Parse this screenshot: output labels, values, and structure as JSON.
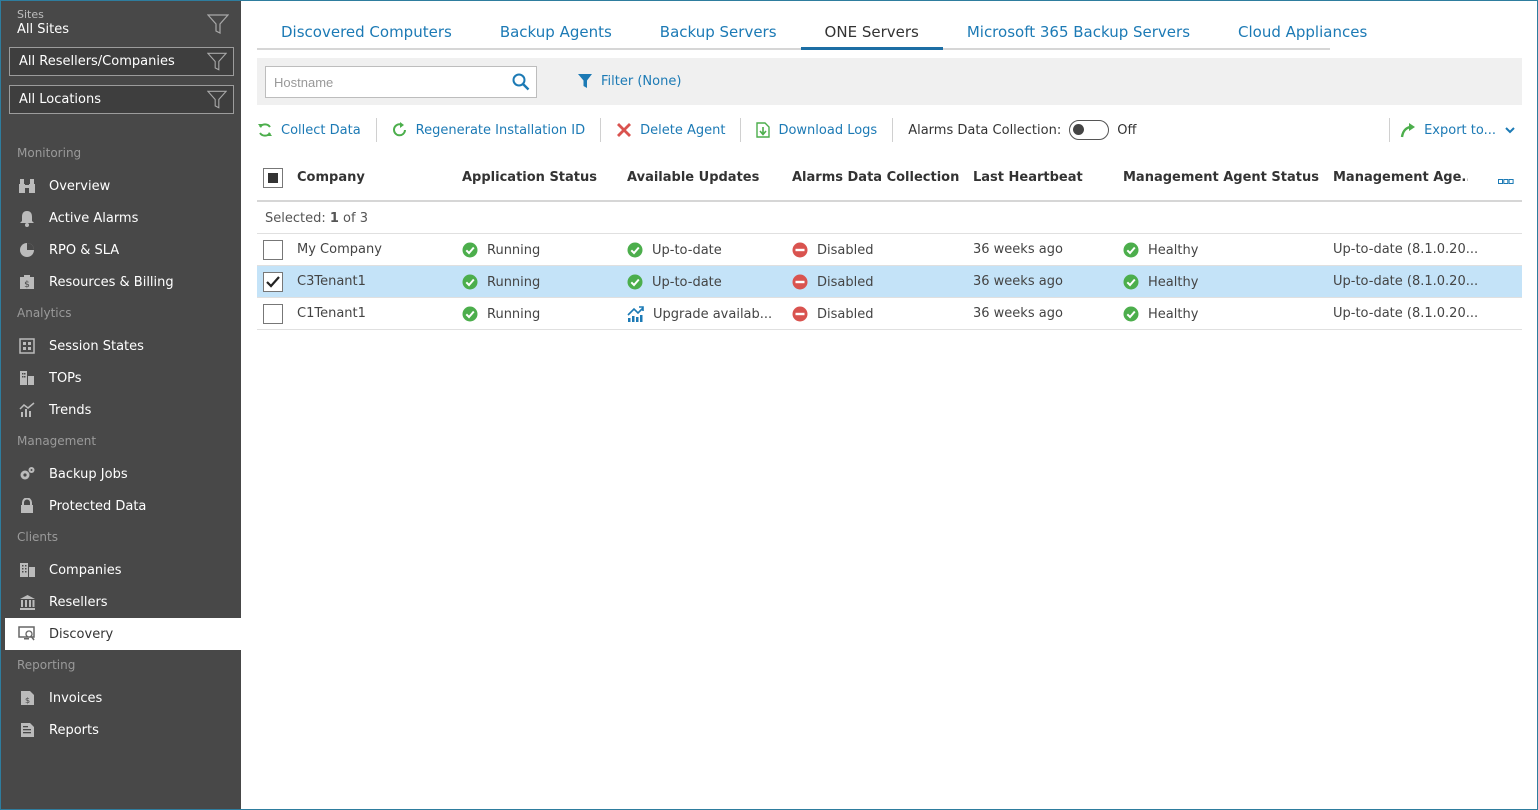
{
  "sidebar": {
    "sites_caption": "Sites",
    "sites_value": "All Sites",
    "resellers_filter": "All Resellers/Companies",
    "locations_filter": "All Locations",
    "sections": {
      "monitoring": "Monitoring",
      "analytics": "Analytics",
      "management": "Management",
      "clients": "Clients",
      "reporting": "Reporting"
    },
    "items": {
      "overview": "Overview",
      "active_alarms": "Active Alarms",
      "rpo_sla": "RPO & SLA",
      "resources_billing": "Resources & Billing",
      "session_states": "Session States",
      "tops": "TOPs",
      "trends": "Trends",
      "backup_jobs": "Backup Jobs",
      "protected_data": "Protected Data",
      "companies": "Companies",
      "resellers": "Resellers",
      "discovery": "Discovery",
      "invoices": "Invoices",
      "reports": "Reports"
    }
  },
  "tabs": {
    "t1": "Discovered Computers",
    "t2": "Backup Agents",
    "t3": "Backup Servers",
    "t4": "ONE Servers",
    "t5": "Microsoft 365 Backup Servers",
    "t6": "Cloud Appliances"
  },
  "search": {
    "placeholder": "Hostname"
  },
  "filter": {
    "label": "Filter (None)"
  },
  "toolbar": {
    "collect_data": "Collect Data",
    "regenerate": "Regenerate Installation ID",
    "delete_agent": "Delete Agent",
    "download_logs": "Download Logs",
    "alarms_label": "Alarms Data Collection:",
    "alarms_state": "Off",
    "export": "Export to..."
  },
  "grid": {
    "headers": {
      "company": "Company",
      "app_status": "Application Status",
      "updates": "Available Updates",
      "alarms": "Alarms Data Collection",
      "heartbeat": "Last Heartbeat",
      "mgmt_status": "Management Agent Status",
      "mgmt_version": "Management Age..."
    },
    "selection": {
      "prefix": "Selected: ",
      "count": "1",
      "suffix": " of 3"
    },
    "rows": [
      {
        "company": "My Company",
        "app_status": "Running",
        "updates": "Up-to-date",
        "alarms": "Disabled",
        "heartbeat": "36 weeks ago",
        "mgmt_status": "Healthy",
        "mgmt_version": "Up-to-date (8.1.0.20...",
        "checked": false
      },
      {
        "company": "C3Tenant1",
        "app_status": "Running",
        "updates": "Up-to-date",
        "alarms": "Disabled",
        "heartbeat": "36 weeks ago",
        "mgmt_status": "Healthy",
        "mgmt_version": "Up-to-date (8.1.0.20...",
        "checked": true
      },
      {
        "company": "C1Tenant1",
        "app_status": "Running",
        "updates": "Upgrade availab...",
        "alarms": "Disabled",
        "heartbeat": "36 weeks ago",
        "mgmt_status": "Healthy",
        "mgmt_version": "Up-to-date (8.1.0.20...",
        "checked": false
      }
    ]
  },
  "colors": {
    "accent": "#1c7ab5",
    "sidebar_bg": "#484848",
    "selected_row": "#c4e3f8",
    "ok_green": "#4cae4c",
    "disabled_red": "#d9534f"
  }
}
